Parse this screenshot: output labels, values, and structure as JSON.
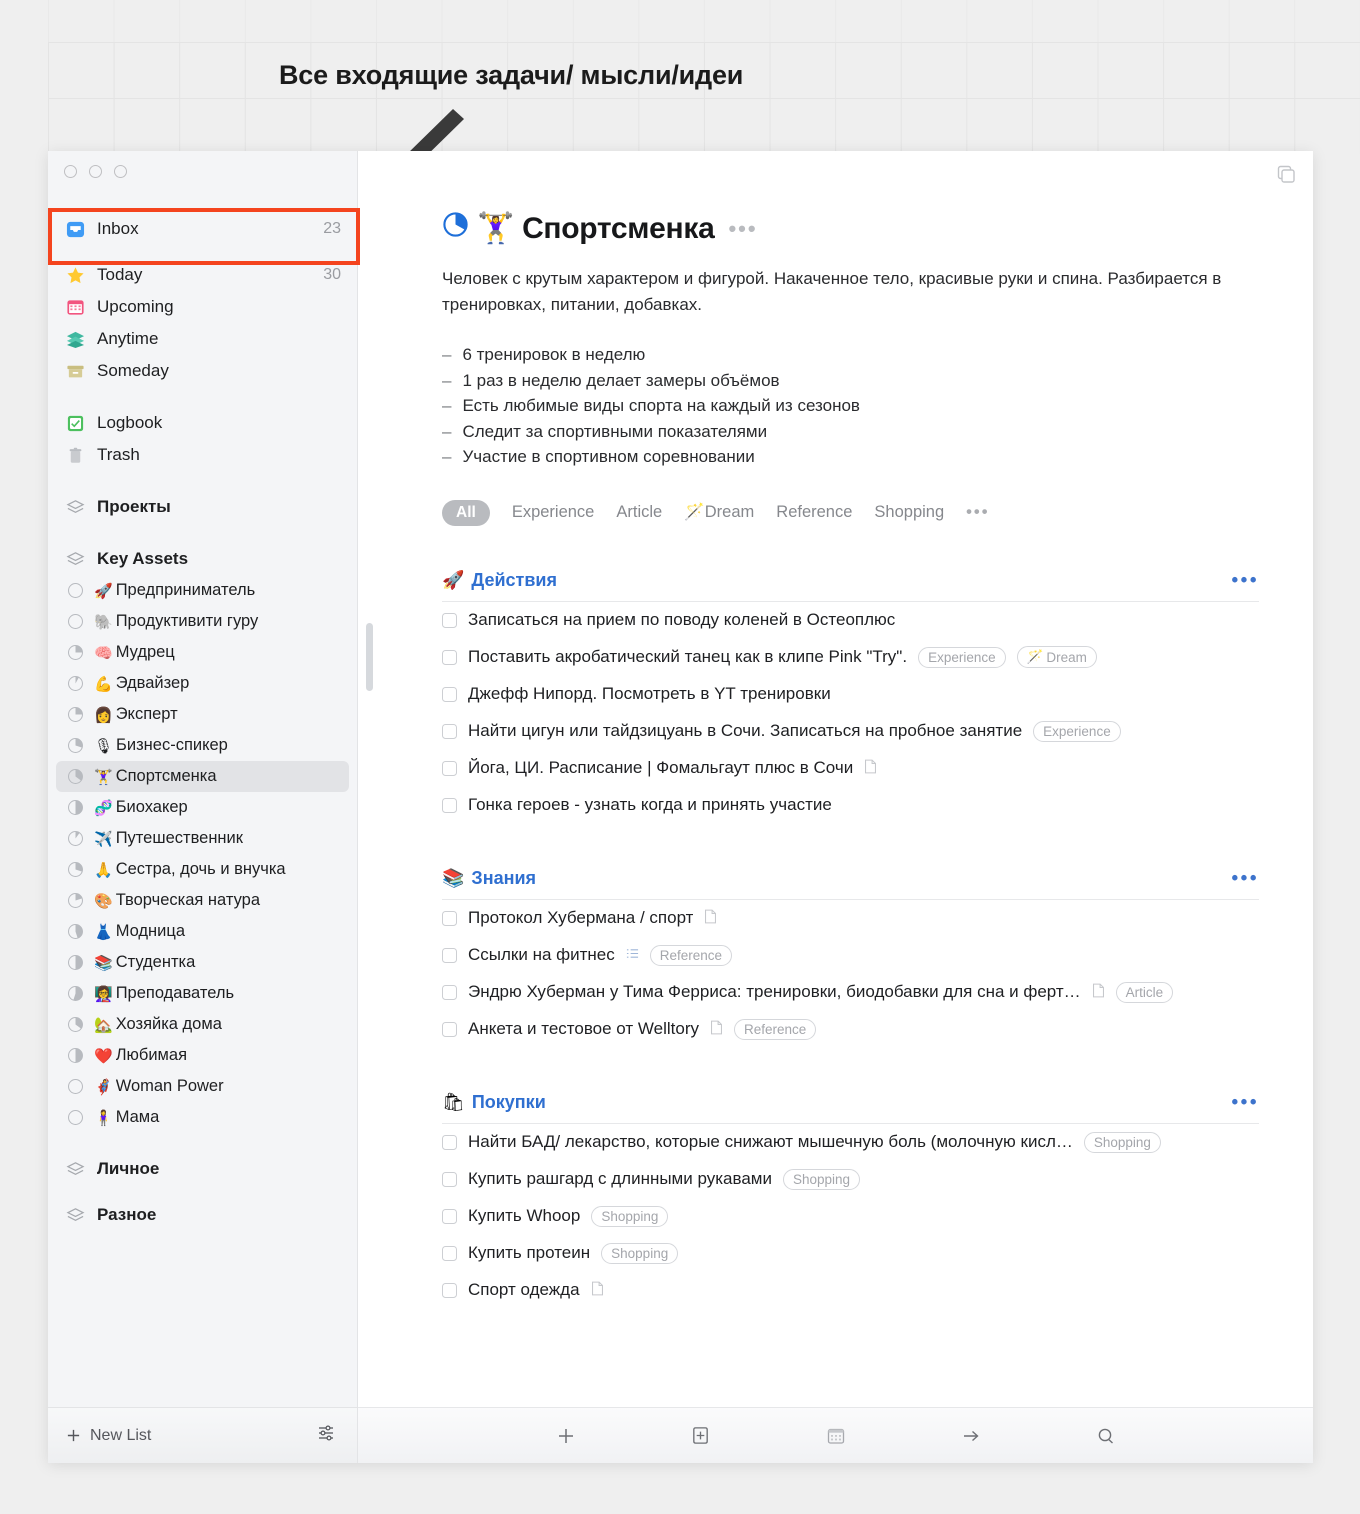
{
  "annotation": {
    "title": "Все входящие задачи/ мысли/идеи",
    "highlight_color": "#f4441e",
    "arrow_color": "#3a3a3a"
  },
  "window": {
    "traffic_lights": [
      "close",
      "minimize",
      "zoom"
    ],
    "sidebar_toggle_icon": "sidebar-toggle-icon"
  },
  "sidebar": {
    "top_items": [
      {
        "label": "Inbox",
        "icon": "inbox-icon",
        "count": "23",
        "highlighted": true
      },
      {
        "label": "Today",
        "icon": "star-icon",
        "count": "30"
      },
      {
        "label": "Upcoming",
        "icon": "calendar-icon",
        "count": ""
      },
      {
        "label": "Anytime",
        "icon": "layers-icon",
        "count": ""
      },
      {
        "label": "Someday",
        "icon": "box-icon",
        "count": ""
      }
    ],
    "util_items": [
      {
        "label": "Logbook",
        "icon": "logbook-icon",
        "count": ""
      },
      {
        "label": "Trash",
        "icon": "trash-icon",
        "count": ""
      }
    ],
    "area_projects": {
      "label": "Проекты",
      "icon": "area-icon"
    },
    "area_key_assets": {
      "label": "Key Assets",
      "icon": "area-icon"
    },
    "projects": [
      {
        "emoji": "🚀",
        "label": "Предприниматель",
        "progress": 0
      },
      {
        "emoji": "🐘",
        "label": "Продуктивити гуру",
        "progress": 0
      },
      {
        "emoji": "🧠",
        "label": "Мудрец",
        "progress": 25
      },
      {
        "emoji": "💪",
        "label": "Эдвайзер",
        "progress": 8
      },
      {
        "emoji": "👩",
        "label": "Эксперт",
        "progress": 25
      },
      {
        "emoji": "🎙",
        "label": "Бизнес-спикер",
        "progress": 30
      },
      {
        "emoji": "🏋️‍♀️",
        "label": "Спортсменка",
        "progress": 35,
        "selected": true
      },
      {
        "emoji": "🧬",
        "label": "Биохакер",
        "progress": 50
      },
      {
        "emoji": "✈️",
        "label": "Путешественник",
        "progress": 10
      },
      {
        "emoji": "🙏",
        "label": "Сестра, дочь и внучка",
        "progress": 30
      },
      {
        "emoji": "🎨",
        "label": "Творческая натура",
        "progress": 20
      },
      {
        "emoji": "👗",
        "label": "Модница",
        "progress": 45
      },
      {
        "emoji": "📚",
        "label": "Студентка",
        "progress": 50
      },
      {
        "emoji": "👩‍🏫",
        "label": "Преподаватель",
        "progress": 55
      },
      {
        "emoji": "🏡",
        "label": "Хозяйка дома",
        "progress": 35
      },
      {
        "emoji": "❤️",
        "label": "Любимая",
        "progress": 50
      },
      {
        "emoji": "🦸‍♀️",
        "label": "Woman Power",
        "progress": 0
      },
      {
        "emoji": "🧍‍♀️",
        "label": "Мама",
        "progress": 0
      }
    ],
    "areas_bottom": [
      {
        "label": "Личное",
        "icon": "area-icon"
      },
      {
        "label": "Разное",
        "icon": "area-icon"
      }
    ],
    "footer": {
      "new_list_label": "New List",
      "new_list_icon": "plus-icon",
      "settings_icon": "sliders-icon"
    }
  },
  "main": {
    "project_icon": "project-progress-icon",
    "title_emoji": "🏋️‍♀️",
    "title": "Спортсменка",
    "title_menu_icon": "ellipsis-icon",
    "description": "Человек с крутым характером и фигурой. Накаченное тело, красивые руки и спина. Разбирается в тренировках, питании, добавках.",
    "bullets": [
      "6 тренировок в неделю",
      "1 раз в неделю делает замеры объёмов",
      "Есть любимые виды спорта на каждый из сезонов",
      "Следит за спортивными показателями",
      "Участие в спортивном соревновании"
    ],
    "filters": {
      "active": "All",
      "items": [
        {
          "label": "Experience",
          "emoji": ""
        },
        {
          "label": "Article",
          "emoji": ""
        },
        {
          "label": "Dream",
          "emoji": "🪄"
        },
        {
          "label": "Reference",
          "emoji": ""
        },
        {
          "label": "Shopping",
          "emoji": ""
        }
      ],
      "more_icon": "ellipsis-icon"
    },
    "sections": [
      {
        "emoji": "🚀",
        "title": "Действия",
        "menu_icon": "ellipsis-icon",
        "tasks": [
          {
            "text": "Записаться на прием по поводу коленей в Остеоплюс",
            "note": false,
            "checklist": false,
            "tags": []
          },
          {
            "text": "Поставить акробатический танец как в клипе Pink \"Try\".",
            "note": false,
            "checklist": false,
            "tags": [
              {
                "label": "Experience",
                "emoji": ""
              },
              {
                "label": "Dream",
                "emoji": "🪄"
              }
            ]
          },
          {
            "text": "Джефф Нипорд. Посмотреть в YT тренировки",
            "note": false,
            "checklist": false,
            "tags": []
          },
          {
            "text": "Найти цигун или тайдзицуань в Сочи. Записаться на пробное занятие",
            "note": false,
            "checklist": false,
            "tags": [
              {
                "label": "Experience",
                "emoji": ""
              }
            ]
          },
          {
            "text": "Йога, ЦИ. Расписание | Фомальгаут плюс в Сочи",
            "note": true,
            "checklist": false,
            "tags": []
          },
          {
            "text": "Гонка героев - узнать когда и принять участие",
            "note": false,
            "checklist": false,
            "tags": []
          }
        ]
      },
      {
        "emoji": "📚",
        "title": "Знания",
        "menu_icon": "ellipsis-icon",
        "tasks": [
          {
            "text": "Протокол Хубермана / спорт",
            "note": true,
            "checklist": false,
            "tags": []
          },
          {
            "text": "Ссылки на фитнес",
            "note": false,
            "checklist": true,
            "tags": [
              {
                "label": "Reference",
                "emoji": ""
              }
            ]
          },
          {
            "text": "Эндрю Хуберман у Тима Ферриса: тренировки, биодобавки для сна и ферт…",
            "note": true,
            "checklist": false,
            "tags": [
              {
                "label": "Article",
                "emoji": ""
              }
            ]
          },
          {
            "text": "Анкета и тестовое от Welltory",
            "note": true,
            "checklist": false,
            "tags": [
              {
                "label": "Reference",
                "emoji": ""
              }
            ]
          }
        ]
      },
      {
        "emoji": "🛍",
        "title": "Покупки",
        "menu_icon": "ellipsis-icon",
        "tasks": [
          {
            "text": "Найти БАД/ лекарство, которые снижают мышечную боль (молочную кисл…",
            "note": false,
            "checklist": false,
            "tags": [
              {
                "label": "Shopping",
                "emoji": ""
              }
            ]
          },
          {
            "text": "Купить рашгард с длинными рукавами",
            "note": false,
            "checklist": false,
            "tags": [
              {
                "label": "Shopping",
                "emoji": ""
              }
            ]
          },
          {
            "text": "Купить Whoop",
            "note": false,
            "checklist": false,
            "tags": [
              {
                "label": "Shopping",
                "emoji": ""
              }
            ]
          },
          {
            "text": "Купить протеин",
            "note": false,
            "checklist": false,
            "tags": [
              {
                "label": "Shopping",
                "emoji": ""
              }
            ]
          },
          {
            "text": "Спорт одежда",
            "note": true,
            "checklist": false,
            "tags": []
          }
        ]
      }
    ],
    "toolbar": [
      {
        "icon": "plus-icon",
        "name": "new-todo-button"
      },
      {
        "icon": "plus-in-box-icon",
        "name": "new-project-button"
      },
      {
        "icon": "calendar-icon",
        "name": "schedule-button"
      },
      {
        "icon": "arrow-right-icon",
        "name": "move-button"
      },
      {
        "icon": "search-icon",
        "name": "search-button"
      }
    ]
  }
}
